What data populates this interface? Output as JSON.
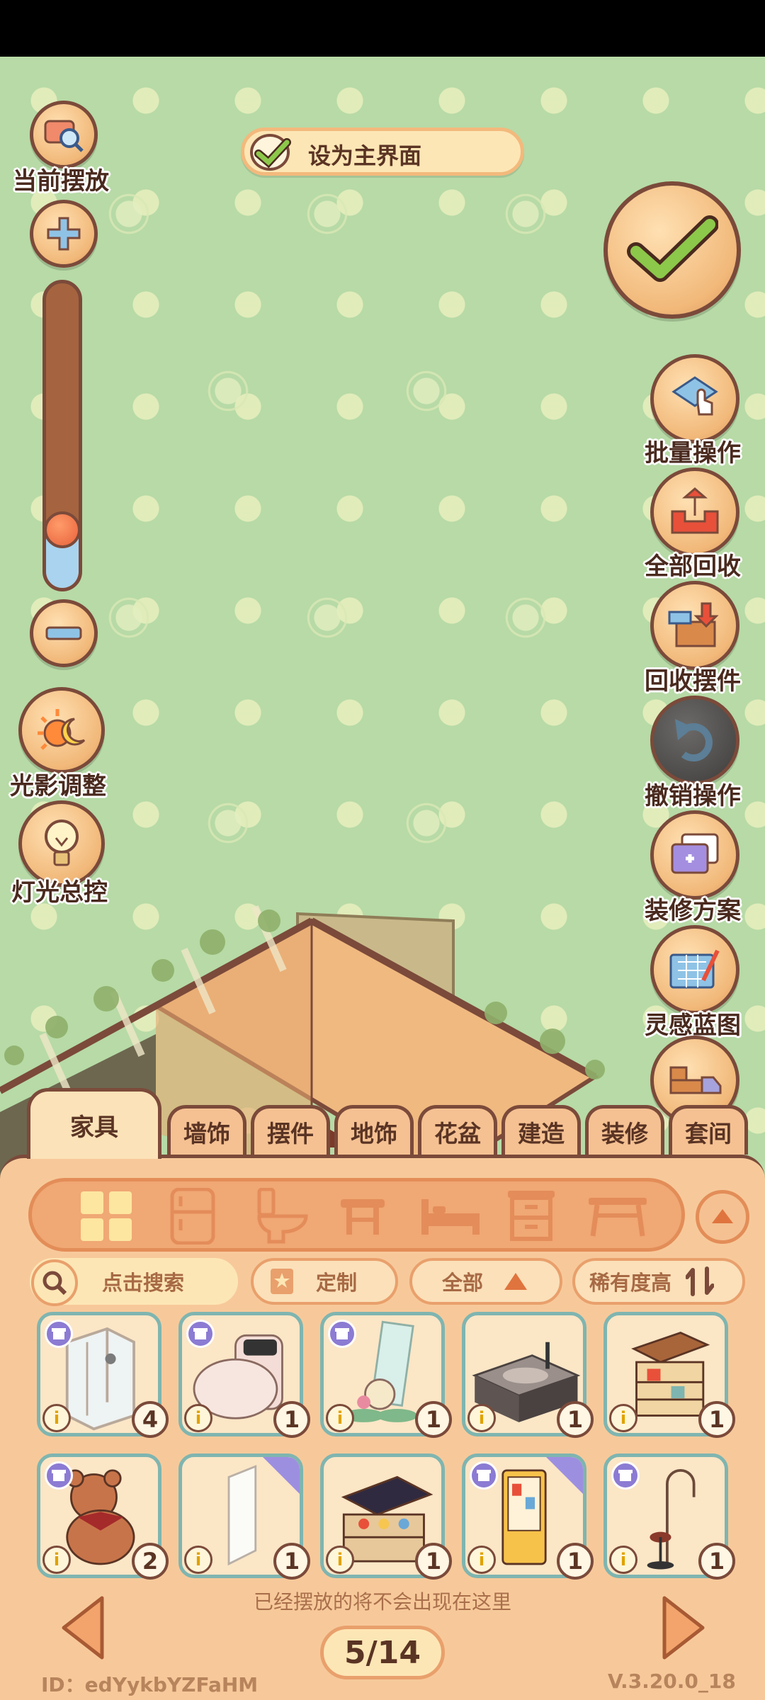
{
  "top": {
    "set_main_label": "设为主界面"
  },
  "left_controls": {
    "current_placed": "当前摆放",
    "light_shadow": "光影调整",
    "light_master": "灯光总控"
  },
  "right_controls": {
    "batch": "批量操作",
    "recycle_all": "全部回收",
    "recycle_items": "回收摆件",
    "undo": "撤销操作",
    "plan": "装修方案",
    "blueprint": "灵感蓝图"
  },
  "tabs": [
    "家具",
    "墙饰",
    "摆件",
    "地饰",
    "花盆",
    "建造",
    "装修",
    "套间"
  ],
  "category_icons": [
    "grid-icon",
    "fridge-icon",
    "toilet-icon",
    "stool-icon",
    "bed-icon",
    "cabinet-icon",
    "table-icon"
  ],
  "filters": {
    "search_placeholder": "点击搜索",
    "custom": "定制",
    "all": "全部",
    "sort": "稀有度高"
  },
  "items": [
    {
      "name": "shower-room",
      "count": "4"
    },
    {
      "name": "smart-toilet",
      "count": "1"
    },
    {
      "name": "flower-scroll",
      "count": "1"
    },
    {
      "name": "sink-cabinet",
      "count": "1"
    },
    {
      "name": "wooden-cart",
      "count": "1"
    },
    {
      "name": "teddy-bear",
      "count": "2"
    },
    {
      "name": "wall-panel",
      "count": "1"
    },
    {
      "name": "paint-cart",
      "count": "1"
    },
    {
      "name": "vending-shelf",
      "count": "1"
    },
    {
      "name": "floor-lamp",
      "count": "1"
    }
  ],
  "info_glyph": "i",
  "hint": "已经摆放的将不会出现在这里",
  "page": "5/14",
  "footer": {
    "id": "ID：edYykbYZFaHM",
    "version": "V.3.20.0_18"
  },
  "zoom_level": 0.18,
  "colors": {
    "accent_brown": "#7b4a3a",
    "panel": "#f7c99a",
    "sky": "#b7daa6"
  }
}
